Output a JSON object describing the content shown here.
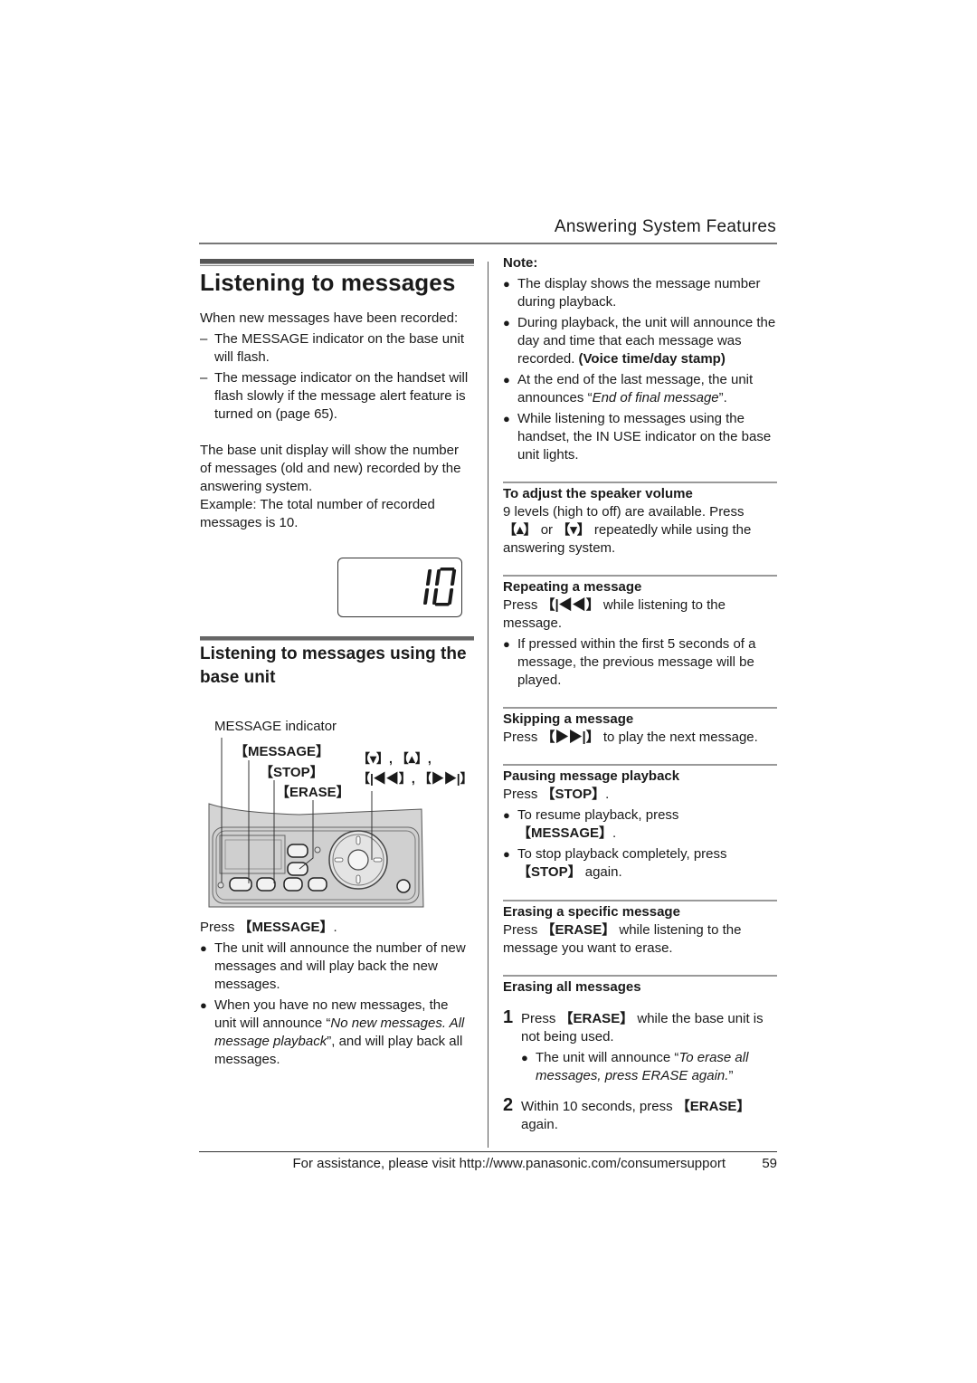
{
  "header": {
    "section_title": "Answering System Features"
  },
  "left": {
    "title": "Listening to messages",
    "intro": "When new messages have been recorded:",
    "dash_items": [
      "The MESSAGE indicator on the base unit will flash.",
      "The message indicator on the handset will flash slowly if the message alert feature is turned on (page 65)."
    ],
    "display_para": "The base unit display will show the number of messages (old and new) recorded by the answering system.",
    "example": "Example: The total number of recorded messages is 10.",
    "lcd_value": "10",
    "subheading": "Listening to messages using the base unit",
    "diagram": {
      "indicator_label": "MESSAGE indicator",
      "key_message": "【MESSAGE】",
      "key_stop": "【STOP】",
      "key_erase": "【ERASE】",
      "key_nav_1": "【▾】, 【▴】,",
      "key_nav_2": "【|◀◀】, 【▶▶|】"
    },
    "press_prefix": "Press ",
    "press_key": "【MESSAGE】",
    "press_suffix": ".",
    "bullets": [
      {
        "text": "The unit will announce the number of new messages and will play back the new messages."
      },
      {
        "pre": "When you have no new messages, the unit will announce “",
        "italic": "No new messages. All message playback",
        "post": "”, and will play back all messages."
      }
    ]
  },
  "right": {
    "note_label": "Note:",
    "notes": [
      {
        "text": "The display shows the message number during playback."
      },
      {
        "pre": "During playback, the unit will announce the day and time that each message was recorded. ",
        "bold": "(Voice time/day stamp)"
      },
      {
        "pre": "At the end of the last message, the unit announces “",
        "italic": "End of final message",
        "post": "”."
      },
      {
        "text": "While listening to messages using the handset, the IN USE indicator on the base unit lights."
      }
    ],
    "volume": {
      "heading": "To adjust the speaker volume",
      "text_1": "9 levels (high to off) are available. Press ",
      "key_up": "【▴】",
      "text_or": " or ",
      "key_down": "【▾】",
      "text_2": " repeatedly while using the answering system."
    },
    "repeat": {
      "heading": "Repeating a message",
      "pre": "Press ",
      "key": "【|◀◀】",
      "post": " while listening to the message.",
      "bullet": "If pressed within the first 5 seconds of a message, the previous message will be played."
    },
    "skip": {
      "heading": "Skipping a message",
      "pre": "Press ",
      "key": "【▶▶|】",
      "post": " to play the next message."
    },
    "pause": {
      "heading": "Pausing message playback",
      "pre": "Press ",
      "key": "【STOP】",
      "post": ".",
      "bullet_1_pre": "To resume playback, press ",
      "bullet_1_key": "【MESSAGE】",
      "bullet_1_post": ".",
      "bullet_2_pre": "To stop playback completely, press ",
      "bullet_2_key": "【STOP】",
      "bullet_2_post": " again."
    },
    "erase_one": {
      "heading": "Erasing a specific message",
      "pre": "Press ",
      "key": "【ERASE】",
      "post": " while listening to the message you want to erase."
    },
    "erase_all": {
      "heading": "Erasing all messages",
      "step_1_num": "1",
      "step_1_pre": "Press ",
      "step_1_key": "【ERASE】",
      "step_1_post": " while the base unit is not being used.",
      "step_1_bullet_pre": "The unit will announce “",
      "step_1_bullet_italic": "To erase all messages, press ERASE again.",
      "step_1_bullet_post": "”",
      "step_2_num": "2",
      "step_2_pre": "Within 10 seconds, press ",
      "step_2_key": "【ERASE】",
      "step_2_post": " again."
    }
  },
  "footer": {
    "assistance": "For assistance, please visit http://www.panasonic.com/consumersupport",
    "page_number": "59"
  },
  "bullet_glyph": "●",
  "dash_glyph": "–"
}
